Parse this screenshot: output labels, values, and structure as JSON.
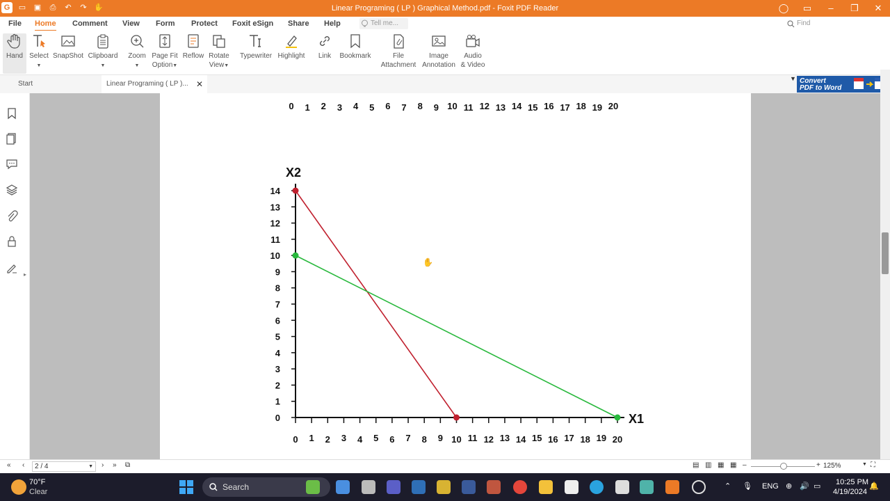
{
  "app": {
    "title": "Linear Programing ( LP ) Graphical Method.pdf - Foxit PDF Reader"
  },
  "menu": {
    "file": "File",
    "home": "Home",
    "comment": "Comment",
    "view": "View",
    "form": "Form",
    "protect": "Protect",
    "esign": "Foxit eSign",
    "share": "Share",
    "help": "Help",
    "tellme": "Tell me...",
    "find": "Find"
  },
  "ribbon": {
    "hand": "Hand",
    "select": "Select",
    "snapshot": "SnapShot",
    "clipboard": "Clipboard",
    "zoom": "Zoom",
    "pagefit1": "Page Fit",
    "pagefit2": "Option",
    "reflow": "Reflow",
    "rotate1": "Rotate",
    "rotate2": "View",
    "typewriter": "Typewriter",
    "highlight": "Highlight",
    "link": "Link",
    "bookmark": "Bookmark",
    "fileatt1": "File",
    "fileatt2": "Attachment",
    "imgann1": "Image",
    "imgann2": "Annotation",
    "av1": "Audio",
    "av2": "& Video"
  },
  "tabs": {
    "start": "Start",
    "doc": "Linear Programing ( LP )..."
  },
  "convert": {
    "l1": "Convert",
    "l2": "PDF to Word"
  },
  "chart_data": {
    "type": "line",
    "xlabel": "X1",
    "ylabel": "X2",
    "xlim": [
      0,
      20
    ],
    "ylim": [
      0,
      14
    ],
    "x_ticks": [
      "0",
      "1",
      "2",
      "3",
      "4",
      "5",
      "6",
      "7",
      "8",
      "9",
      "10",
      "11",
      "12",
      "13",
      "14",
      "15",
      "16",
      "17",
      "18",
      "19",
      "20"
    ],
    "y_ticks": [
      "0",
      "1",
      "2",
      "3",
      "4",
      "5",
      "6",
      "7",
      "8",
      "9",
      "10",
      "11",
      "12",
      "13",
      "14"
    ],
    "series": [
      {
        "color": "#c0202e",
        "points": [
          [
            0,
            14
          ],
          [
            10,
            0
          ]
        ]
      },
      {
        "color": "#28b83c",
        "points": [
          [
            0,
            10
          ],
          [
            20,
            0
          ]
        ]
      }
    ]
  },
  "status": {
    "page": "2 / 4",
    "zoom": "125%"
  },
  "taskbar": {
    "temp": "70°F",
    "weather": "Clear",
    "search": "Search",
    "lang": "ENG",
    "time": "10:25 PM",
    "date": "4/19/2024"
  }
}
